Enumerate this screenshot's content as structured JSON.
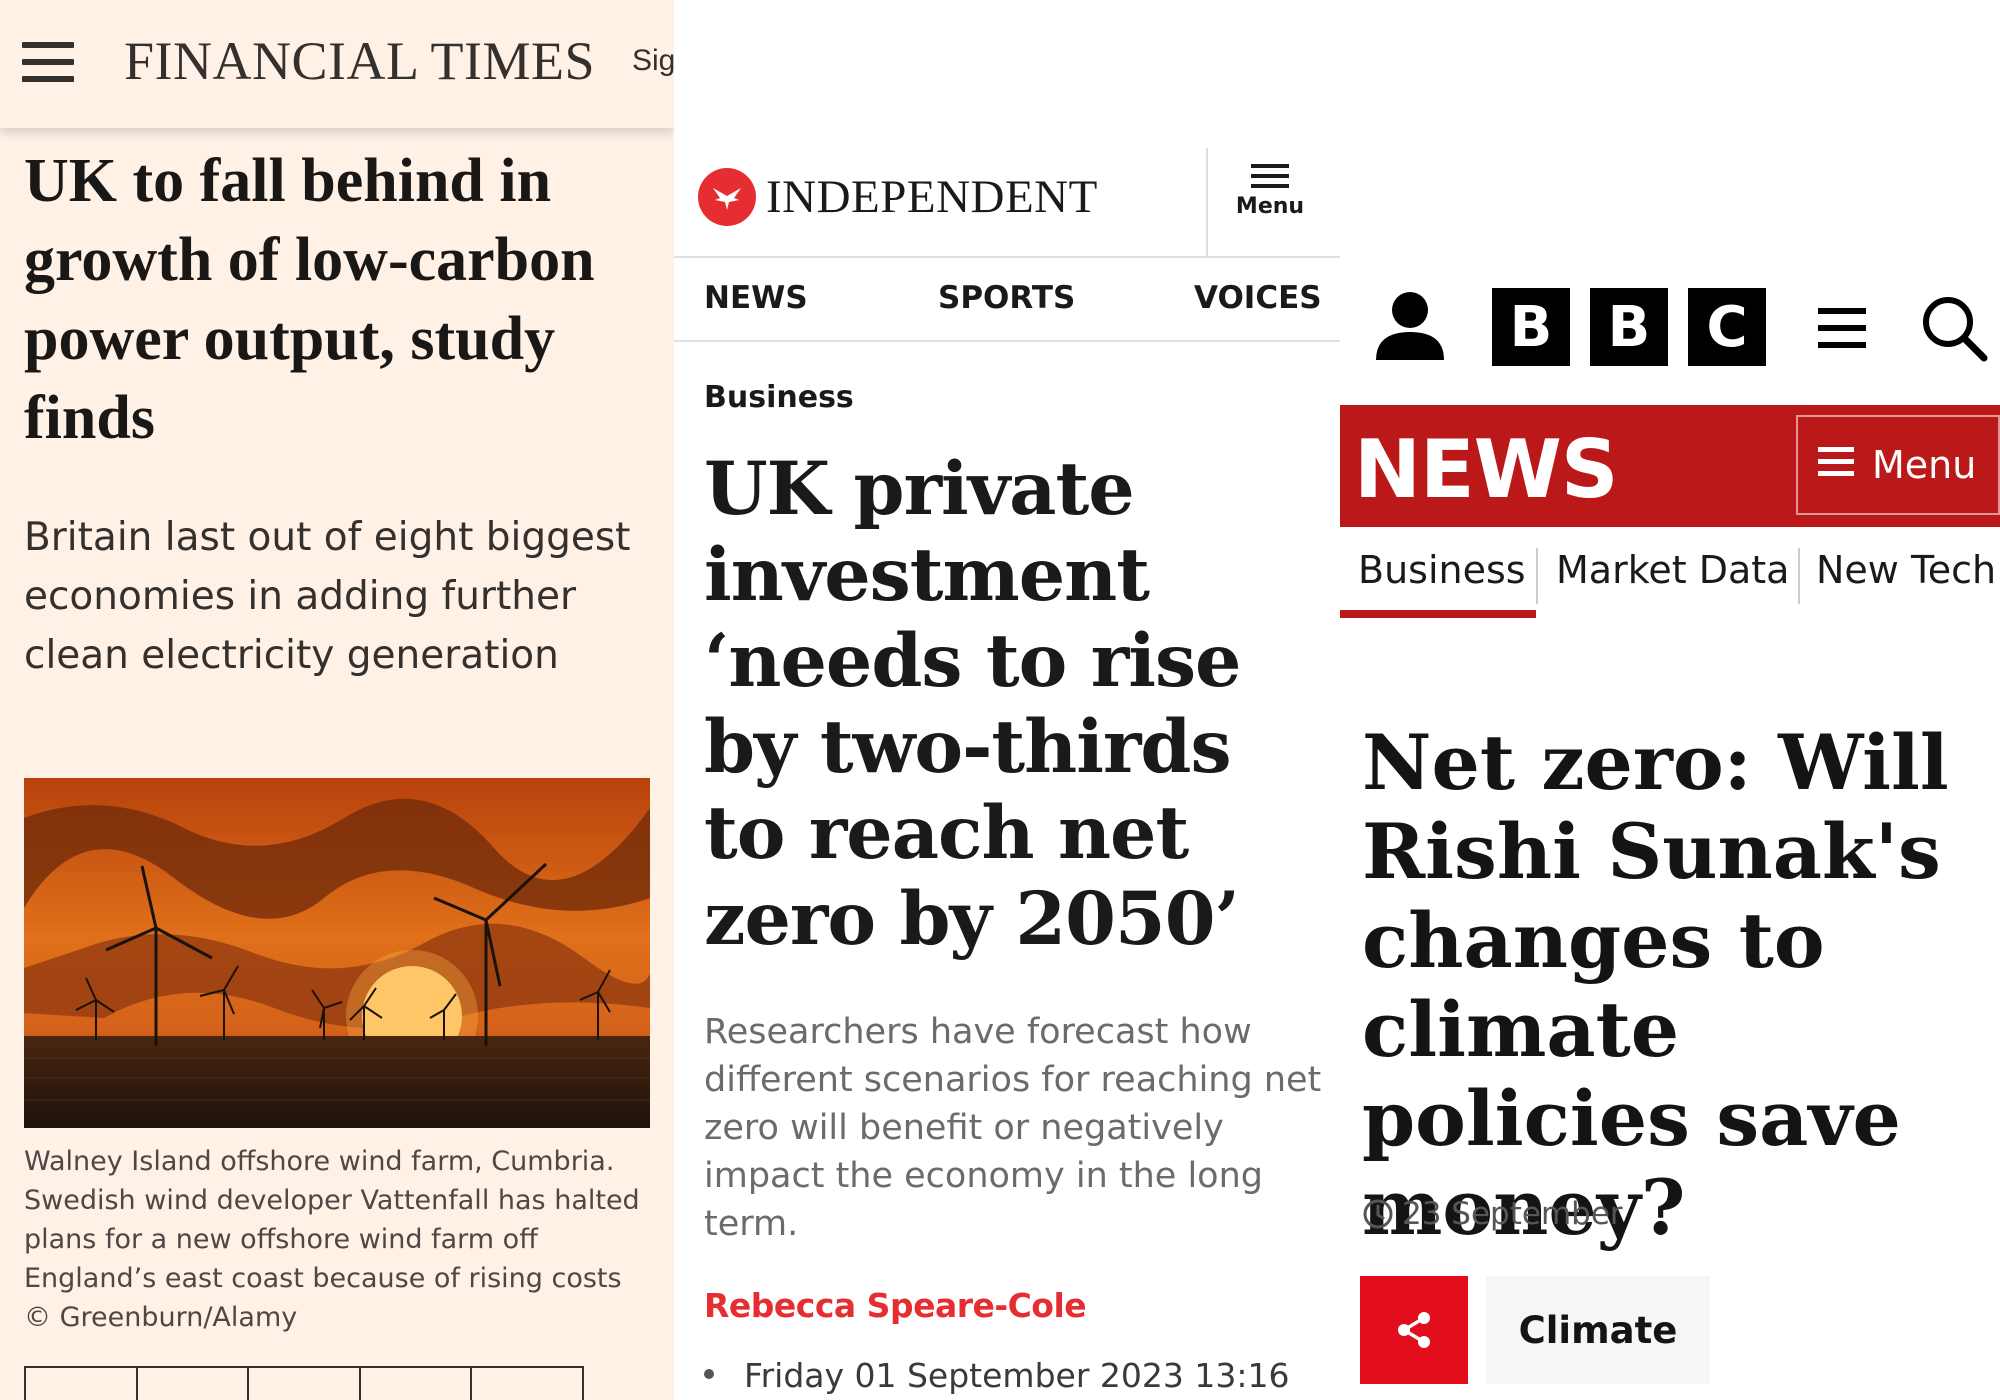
{
  "ft": {
    "logo": "FINANCIAL TIMES",
    "signin": "Sig",
    "headline": "UK to fall behind in growth of low-carbon power output, study finds",
    "standfirst": "Britain last out of eight biggest economies in adding further clean electricity generation",
    "caption": "Walney Island offshore wind farm, Cumbria. Swedish wind developer Vattenfall has halted plans for a new offshore wind farm off England’s east coast because of rising costs © Greenburn/Alamy",
    "share_icons": [
      "x-icon",
      "facebook-icon",
      "linkedin-icon",
      "whatsapp-icon",
      "bookmark-icon"
    ]
  },
  "independent": {
    "logo": "INDEPENDENT",
    "menu_label": "Menu",
    "nav": [
      "NEWS",
      "SPORTS",
      "VOICES"
    ],
    "section": "Business",
    "headline": "UK private investment ‘needs to rise by two-thirds to reach net zero by 2050’",
    "subheadline": "Researchers have forecast how different scenarios for reaching net zero will benefit or negatively impact the economy in the long term.",
    "author": "Rebecca Speare-Cole",
    "date": "Friday 01 September 2023 13:16",
    "accent_color": "#e62e32"
  },
  "bbc": {
    "logo_blocks": [
      "B",
      "B",
      "C"
    ],
    "news_label": "NEWS",
    "menu_label": "Menu",
    "subnav": [
      "Business",
      "Market Data",
      "New Tech"
    ],
    "active_subnav": "Business",
    "headline": "Net zero: Will Rishi Sunak's changes to climate policies save money?",
    "date": "23 September",
    "tag": "Climate",
    "accent_color": "#bb1919"
  }
}
